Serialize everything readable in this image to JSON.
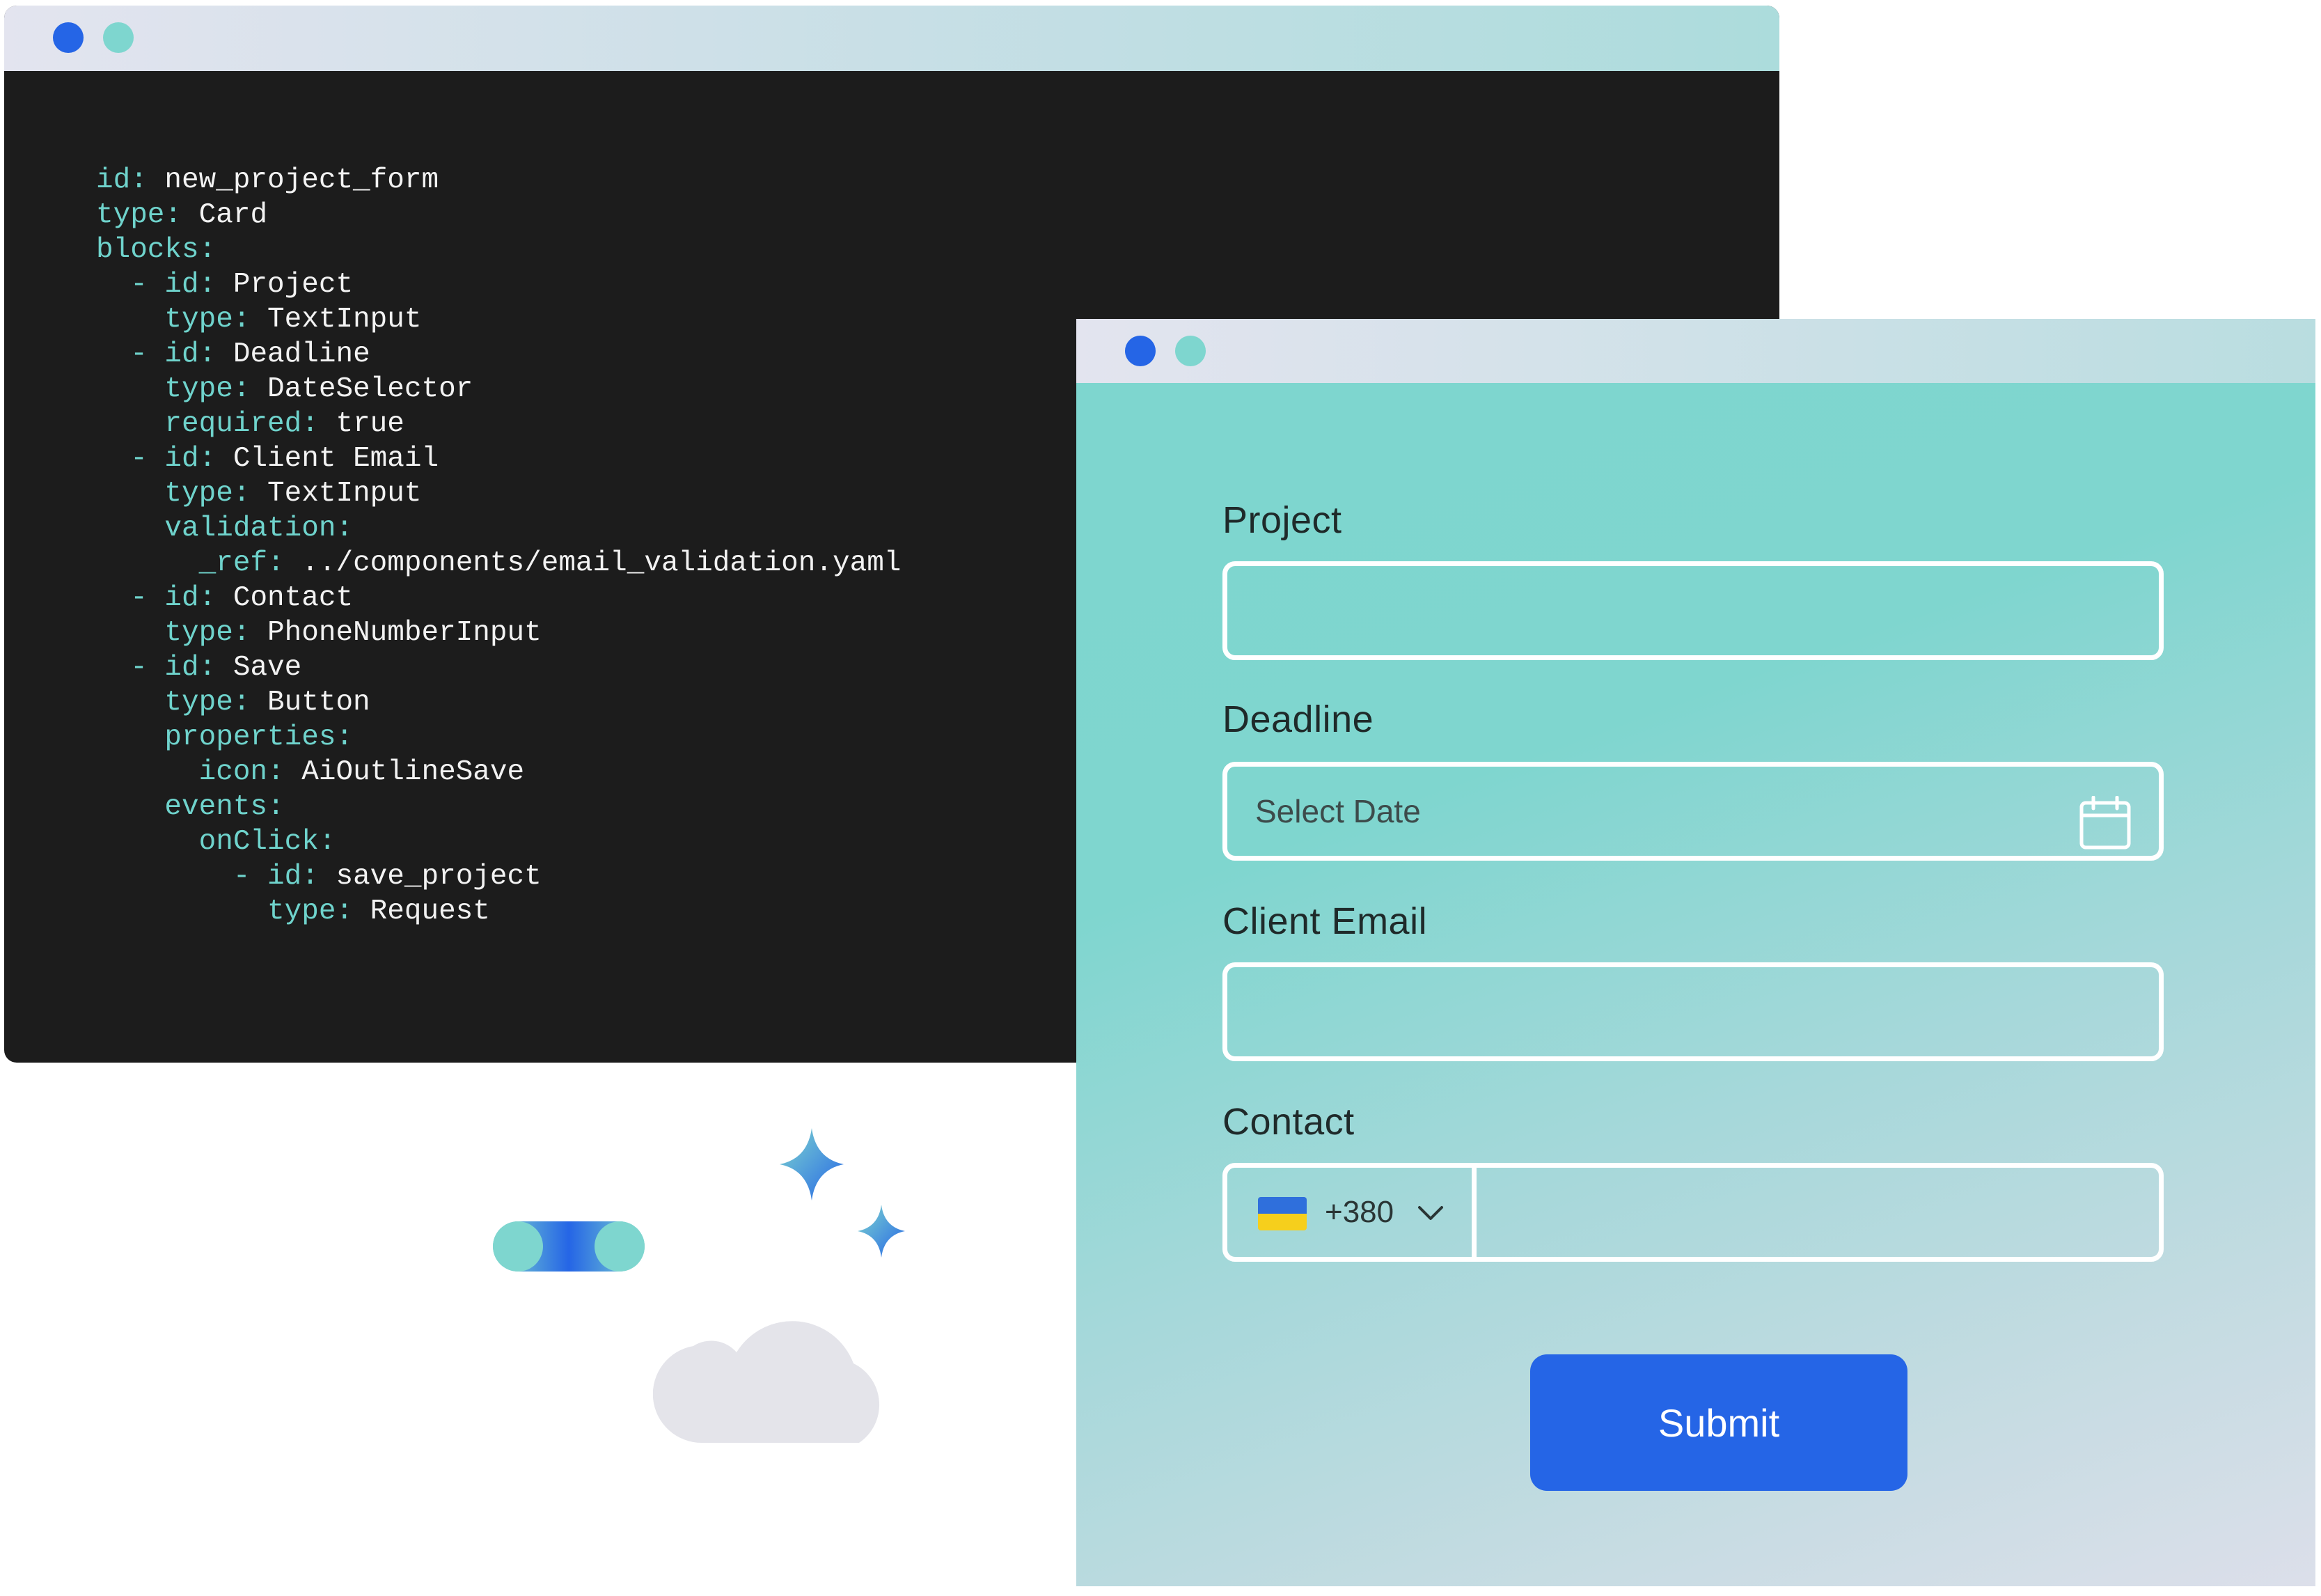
{
  "colors": {
    "code_background": "#1c1c1c",
    "code_key": "#6fd3cc",
    "code_value": "#f2f2f2",
    "window_dot_primary": "#2565e6",
    "window_dot_secondary": "#7ed6cf",
    "form_teal": "#7ed6cf",
    "submit_blue": "#2565e6",
    "cloud_gray": "#e4e4ea"
  },
  "code_window": {
    "lines": [
      {
        "key": "id:",
        "value": " new_project_form"
      },
      {
        "key": "type:",
        "value": " Card"
      },
      {
        "key": "blocks:",
        "value": ""
      },
      {
        "key": "  - id:",
        "value": " Project"
      },
      {
        "key": "    type:",
        "value": " TextInput"
      },
      {
        "key": "  - id:",
        "value": " Deadline"
      },
      {
        "key": "    type:",
        "value": " DateSelector"
      },
      {
        "key": "    required:",
        "value": " true"
      },
      {
        "key": "  - id:",
        "value": " Client Email"
      },
      {
        "key": "    type:",
        "value": " TextInput"
      },
      {
        "key": "    validation:",
        "value": ""
      },
      {
        "key": "      _ref:",
        "value": " ../components/email_validation.yaml"
      },
      {
        "key": "  - id:",
        "value": " Contact"
      },
      {
        "key": "    type:",
        "value": " PhoneNumberInput"
      },
      {
        "key": "  - id:",
        "value": " Save"
      },
      {
        "key": "    type:",
        "value": " Button"
      },
      {
        "key": "    properties:",
        "value": ""
      },
      {
        "key": "      icon:",
        "value": " AiOutlineSave"
      },
      {
        "key": "    events:",
        "value": ""
      },
      {
        "key": "      onClick:",
        "value": ""
      },
      {
        "key": "        - id:",
        "value": " save_project"
      },
      {
        "key": "          type:",
        "value": " Request"
      }
    ]
  },
  "form": {
    "project": {
      "label": "Project",
      "value": ""
    },
    "deadline": {
      "label": "Deadline",
      "placeholder": "Select Date",
      "icon": "calendar-icon"
    },
    "client_email": {
      "label": "Client Email",
      "value": ""
    },
    "contact": {
      "label": "Contact",
      "flag": "ukraine-flag-icon",
      "dial_code": "+380",
      "value": ""
    },
    "submit_label": "Submit"
  },
  "decorations": {
    "icons": [
      "sparkle-large-icon",
      "sparkle-small-icon",
      "pill-toggle-icon",
      "cloud-icon"
    ]
  }
}
